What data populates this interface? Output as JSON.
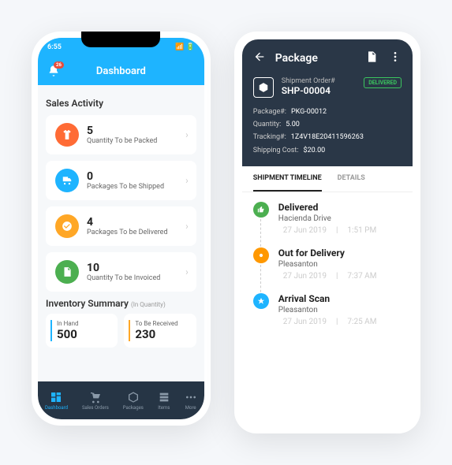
{
  "dashboard": {
    "time": "6:55",
    "title": "Dashboard",
    "notifications": "26",
    "section_sales": "Sales Activity",
    "cards": [
      {
        "num": "5",
        "lbl": "Quantity To be Packed"
      },
      {
        "num": "0",
        "lbl": "Packages To be Shipped"
      },
      {
        "num": "4",
        "lbl": "Packages To be Delivered"
      },
      {
        "num": "10",
        "lbl": "Quantity To be Invoiced"
      }
    ],
    "section_inv": "Inventory Summary",
    "section_inv_sub": "(In Quantity)",
    "inv": [
      {
        "lbl": "In Hand",
        "num": "500"
      },
      {
        "lbl": "To Be Received",
        "num": "230"
      }
    ],
    "tabs": [
      "Dashboard",
      "Sales Orders",
      "Packages",
      "Items",
      "More"
    ]
  },
  "package": {
    "title": "Package",
    "ship_label": "Shipment Order#",
    "ship_id": "SHP-00004",
    "status": "DELIVERED",
    "meta": {
      "pkg_l": "Package#:",
      "pkg_v": "PKG-00012",
      "qty_l": "Quantity:",
      "qty_v": "5.00",
      "trk_l": "Tracking#:",
      "trk_v": "1Z4V18E20411596263",
      "cost_l": "Shipping Cost:",
      "cost_v": "$20.00"
    },
    "tabs": [
      "SHIPMENT TIMELINE",
      "DETAILS"
    ],
    "timeline": [
      {
        "title": "Delivered",
        "loc": "Hacienda Drive",
        "date": "27 Jun 2019",
        "time": "1:51 PM"
      },
      {
        "title": "Out for Delivery",
        "loc": "Pleasanton",
        "date": "27 Jun 2019",
        "time": "7:37 AM"
      },
      {
        "title": "Arrival Scan",
        "loc": "Pleasanton",
        "date": "27 Jun 2019",
        "time": "7:25 AM"
      }
    ]
  }
}
